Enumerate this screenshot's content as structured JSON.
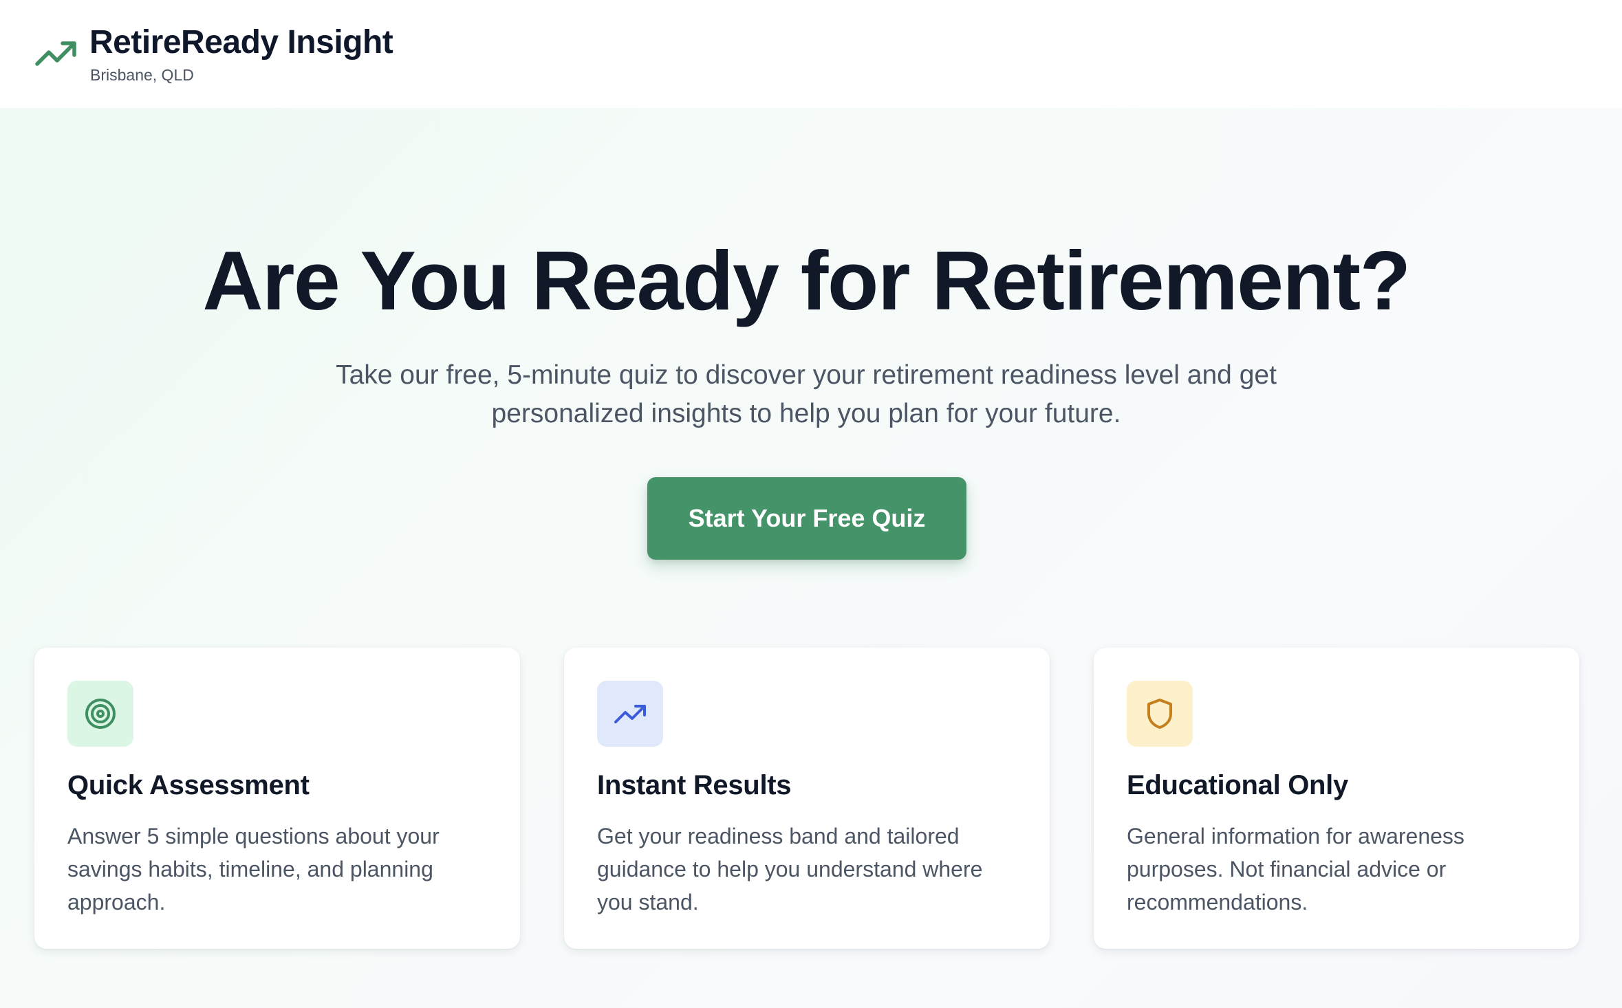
{
  "brand": {
    "name": "RetireReady Insight",
    "location": "Brisbane, QLD",
    "icon": "trending-up-icon",
    "accent_color": "#459469"
  },
  "hero": {
    "title": "Are You Ready for Retirement?",
    "subtitle": "Take our free, 5-minute quiz to discover your retirement readiness level and get personalized insights to help you plan for your future.",
    "cta_label": "Start Your Free Quiz"
  },
  "features": [
    {
      "icon": "target-icon",
      "icon_bg": "#dcf6e6",
      "icon_color": "#3f8f62",
      "title": "Quick Assessment",
      "description": "Answer 5 simple questions about your savings habits, timeline, and planning approach."
    },
    {
      "icon": "trending-up-icon",
      "icon_bg": "#e0e8fb",
      "icon_color": "#3b5bdb",
      "title": "Instant Results",
      "description": "Get your readiness band and tailored guidance to help you understand where you stand."
    },
    {
      "icon": "shield-icon",
      "icon_bg": "#fdf1cc",
      "icon_color": "#c77f1e",
      "title": "Educational Only",
      "description": "General information for awareness purposes. Not financial advice or recommendations."
    }
  ]
}
